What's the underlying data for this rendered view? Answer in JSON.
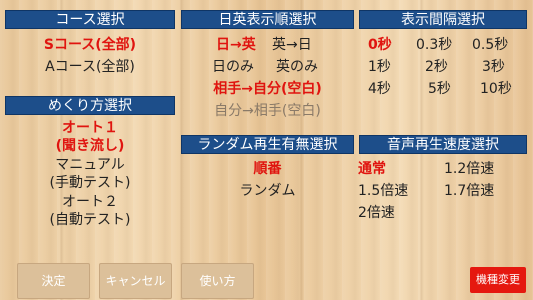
{
  "course": {
    "header": "コース選択",
    "options": [
      "Sコース(全部)",
      "Aコース(全部)"
    ]
  },
  "flip": {
    "header": "めくり方選択",
    "auto1_line1": "オート１",
    "auto1_line2": "(聞き流し)",
    "manual_line1": "マニュアル",
    "manual_line2": "(手動テスト)",
    "auto2_line1": "オート２",
    "auto2_line2": "(自動テスト)"
  },
  "order": {
    "header": "日英表示順選択",
    "opt1": "日→英",
    "opt2": "英→日",
    "opt3": "日のみ",
    "opt4": "英のみ",
    "opt5": "相手→自分(空白)",
    "opt6": "自分→相手(空白)"
  },
  "random": {
    "header": "ランダム再生有無選択",
    "opt1": "順番",
    "opt2": "ランダム"
  },
  "interval": {
    "header": "表示間隔選択",
    "opts": [
      "0秒",
      "0.3秒",
      "0.5秒",
      "1秒",
      "2秒",
      "3秒",
      "4秒",
      "5秒",
      "10秒"
    ]
  },
  "speed": {
    "header": "音声再生速度選択",
    "opts": [
      "通常",
      "1.2倍速",
      "1.5倍速",
      "1.7倍速",
      "2倍速"
    ]
  },
  "buttons": {
    "ok": "決定",
    "cancel": "キャンセル",
    "howto": "使い方",
    "device": "機種変更"
  }
}
